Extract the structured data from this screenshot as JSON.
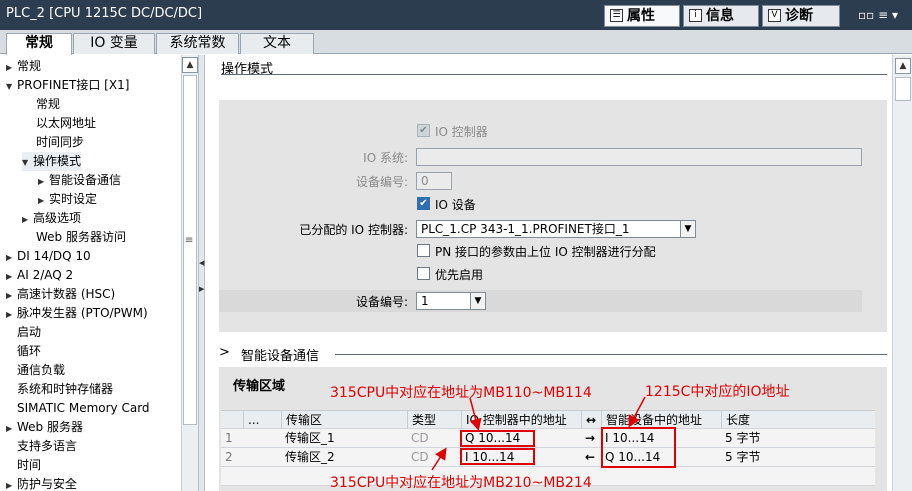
{
  "window": {
    "title": "PLC_2 [CPU 1215C DC/DC/DC]"
  },
  "panel_tabs": [
    {
      "label": "属性",
      "icon": "properties-icon",
      "icon_glyph": "☰"
    },
    {
      "label": "信息",
      "icon": "info-icon",
      "icon_glyph": "i"
    },
    {
      "label": "诊断",
      "icon": "diagnostics-icon",
      "icon_glyph": "V"
    }
  ],
  "window_controls": {
    "icon": "window-controls-icon",
    "glyph": "▫▫ ≡ ▾"
  },
  "tabs": [
    "常规",
    "IO 变量",
    "系统常数",
    "文本"
  ],
  "tree": [
    {
      "label": "常规",
      "arrow": "▶"
    },
    {
      "label": "PROFINET接口 [X1]",
      "arrow": "▼"
    },
    {
      "label": "常规",
      "arrow": ""
    },
    {
      "label": "以太网地址",
      "arrow": ""
    },
    {
      "label": "时间同步",
      "arrow": ""
    },
    {
      "label": "操作模式",
      "arrow": "▼"
    },
    {
      "label": "智能设备通信",
      "arrow": "▶"
    },
    {
      "label": "实时设定",
      "arrow": "▶"
    },
    {
      "label": "高级选项",
      "arrow": "▶"
    },
    {
      "label": "Web 服务器访问",
      "arrow": ""
    },
    {
      "label": "DI 14/DQ 10",
      "arrow": "▶"
    },
    {
      "label": "AI 2/AQ 2",
      "arrow": "▶"
    },
    {
      "label": "高速计数器 (HSC)",
      "arrow": "▶"
    },
    {
      "label": "脉冲发生器 (PTO/PWM)",
      "arrow": "▶"
    },
    {
      "label": "启动",
      "arrow": ""
    },
    {
      "label": "循环",
      "arrow": ""
    },
    {
      "label": "通信负载",
      "arrow": ""
    },
    {
      "label": "系统和时钟存储器",
      "arrow": ""
    },
    {
      "label": "SIMATIC Memory Card",
      "arrow": ""
    },
    {
      "label": "Web 服务器",
      "arrow": "▶"
    },
    {
      "label": "支持多语言",
      "arrow": ""
    },
    {
      "label": "时间",
      "arrow": ""
    },
    {
      "label": "防护与安全",
      "arrow": "▶"
    }
  ],
  "operating_mode": {
    "title": "操作模式",
    "io_controller_label": "IO 控制器",
    "io_system_label": "IO 系统:",
    "io_system_value": "",
    "device_number_label": "设备编号:",
    "device_number_value": "0",
    "io_device_label": "IO 设备",
    "assigned_controller_label": "已分配的 IO 控制器:",
    "assigned_controller_value": "PLC_1.CP 343-1_1.PROFINET接口_1",
    "pn_param_label": "PN 接口的参数由上位 IO 控制器进行分配",
    "priority_label": "优先启用",
    "device_number2_label": "设备编号:",
    "device_number2_value": "1"
  },
  "smart_device": {
    "title": "智能设备通信",
    "arrow": ">"
  },
  "transfer": {
    "title": "传输区域",
    "headers": [
      "",
      "...",
      "传输区",
      "类型",
      "IO 控制器中的地址",
      "↔",
      "智能设备中的地址",
      "长度"
    ],
    "rows": [
      {
        "num": "1",
        "name": "传输区_1",
        "type": "CD",
        "ctrl_addr": "Q 10...14",
        "dir": "→",
        "dev_addr": "I 10...14",
        "length": "5 字节"
      },
      {
        "num": "2",
        "name": "传输区_2",
        "type": "CD",
        "ctrl_addr": "I 10...14",
        "dir": "←",
        "dev_addr": "Q 10...14",
        "length": "5 字节"
      }
    ]
  },
  "annotations": {
    "top_left": "315CPU中对应在地址为MB110~MB114",
    "top_right": "1215C中对应的IO地址",
    "bottom": "315CPU中对应在地址为MB210~MB214"
  },
  "scroll_glyphs": {
    "up": "▲",
    "down": "▼",
    "left": "◀",
    "right": "▶",
    "grip": "≡",
    "dd": "▼"
  },
  "checks": {
    "mark": "✔"
  },
  "colors": {
    "titlebar": "#2b3d4e",
    "annotation": "#e00000",
    "checkbox_on": "#2f6fb0"
  }
}
